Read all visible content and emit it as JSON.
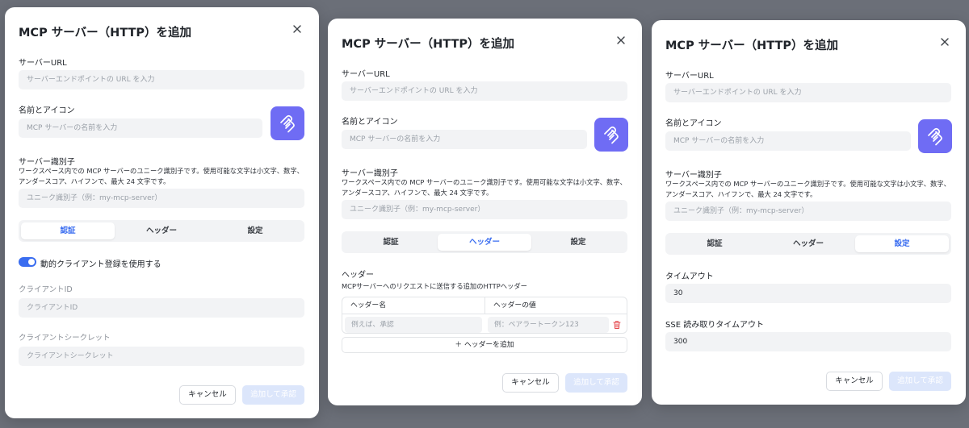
{
  "dialogs": [
    {
      "title": "MCP サーバー（HTTP）を追加",
      "server_url_label": "サーバーURL",
      "server_url_placeholder": "サーバーエンドポイントの URL を入力",
      "name_icon_label": "名前とアイコン",
      "name_placeholder": "MCP サーバーの名前を入力",
      "identifier_label": "サーバー識別子",
      "identifier_help": "ワークスペース内での MCP サーバーのユニーク識別子です。使用可能な文字は小文字、数字、アンダースコア、ハイフンで、最大 24 文字です。",
      "identifier_placeholder": "ユニーク識別子（例：my-mcp-server）",
      "tabs": [
        "認証",
        "ヘッダー",
        "設定"
      ],
      "active_tab": "認証",
      "dynamic_client_label": "動的クライアント登録を使用する",
      "dynamic_client_enabled": true,
      "client_id_label": "クライアントID",
      "client_id_placeholder": "クライアントID",
      "client_secret_label": "クライアントシークレット",
      "client_secret_placeholder": "クライアントシークレット",
      "cancel_label": "キャンセル",
      "submit_label": "追加して承認"
    },
    {
      "title": "MCP サーバー（HTTP）を追加",
      "server_url_label": "サーバーURL",
      "server_url_placeholder": "サーバーエンドポイントの URL を入力",
      "name_icon_label": "名前とアイコン",
      "name_placeholder": "MCP サーバーの名前を入力",
      "identifier_label": "サーバー識別子",
      "identifier_help": "ワークスペース内での MCP サーバーのユニーク識別子です。使用可能な文字は小文字、数字、アンダースコア、ハイフンで、最大 24 文字です。",
      "identifier_placeholder": "ユニーク識別子（例：my-mcp-server）",
      "tabs": [
        "認証",
        "ヘッダー",
        "設定"
      ],
      "active_tab": "ヘッダー",
      "headers_label": "ヘッダー",
      "headers_help": "MCPサーバーへのリクエストに送信する追加のHTTPヘッダー",
      "header_name_col": "ヘッダー名",
      "header_value_col": "ヘッダーの値",
      "header_name_placeholder": "例えば、承認",
      "header_value_placeholder": "例：ベアラートークン123",
      "add_header_label": "＋ ヘッダーを追加",
      "cancel_label": "キャンセル",
      "submit_label": "追加して承認"
    },
    {
      "title": "MCP サーバー（HTTP）を追加",
      "server_url_label": "サーバーURL",
      "server_url_placeholder": "サーバーエンドポイントの URL を入力",
      "name_icon_label": "名前とアイコン",
      "name_placeholder": "MCP サーバーの名前を入力",
      "identifier_label": "サーバー識別子",
      "identifier_help": "ワークスペース内での MCP サーバーのユニーク識別子です。使用可能な文字は小文字、数字、アンダースコア、ハイフンで、最大 24 文字です。",
      "identifier_placeholder": "ユニーク識別子（例：my-mcp-server）",
      "tabs": [
        "認証",
        "ヘッダー",
        "設定"
      ],
      "active_tab": "設定",
      "timeout_label": "タイムアウト",
      "timeout_value": "30",
      "sse_timeout_label": "SSE 読み取りタイムアウト",
      "sse_timeout_value": "300",
      "cancel_label": "キャンセル",
      "submit_label": "追加して承認"
    }
  ],
  "colors": {
    "accent": "#3a6df0",
    "icon_bg": "#6f6cf4",
    "field_bg": "#f2f3f5",
    "submit_disabled_bg": "#dce6fb",
    "trash": "#e5484d"
  },
  "icons": {
    "close": "close-icon",
    "server_icon": "mcp-logo-icon",
    "trash": "trash-icon",
    "toggle": "toggle-switch"
  }
}
